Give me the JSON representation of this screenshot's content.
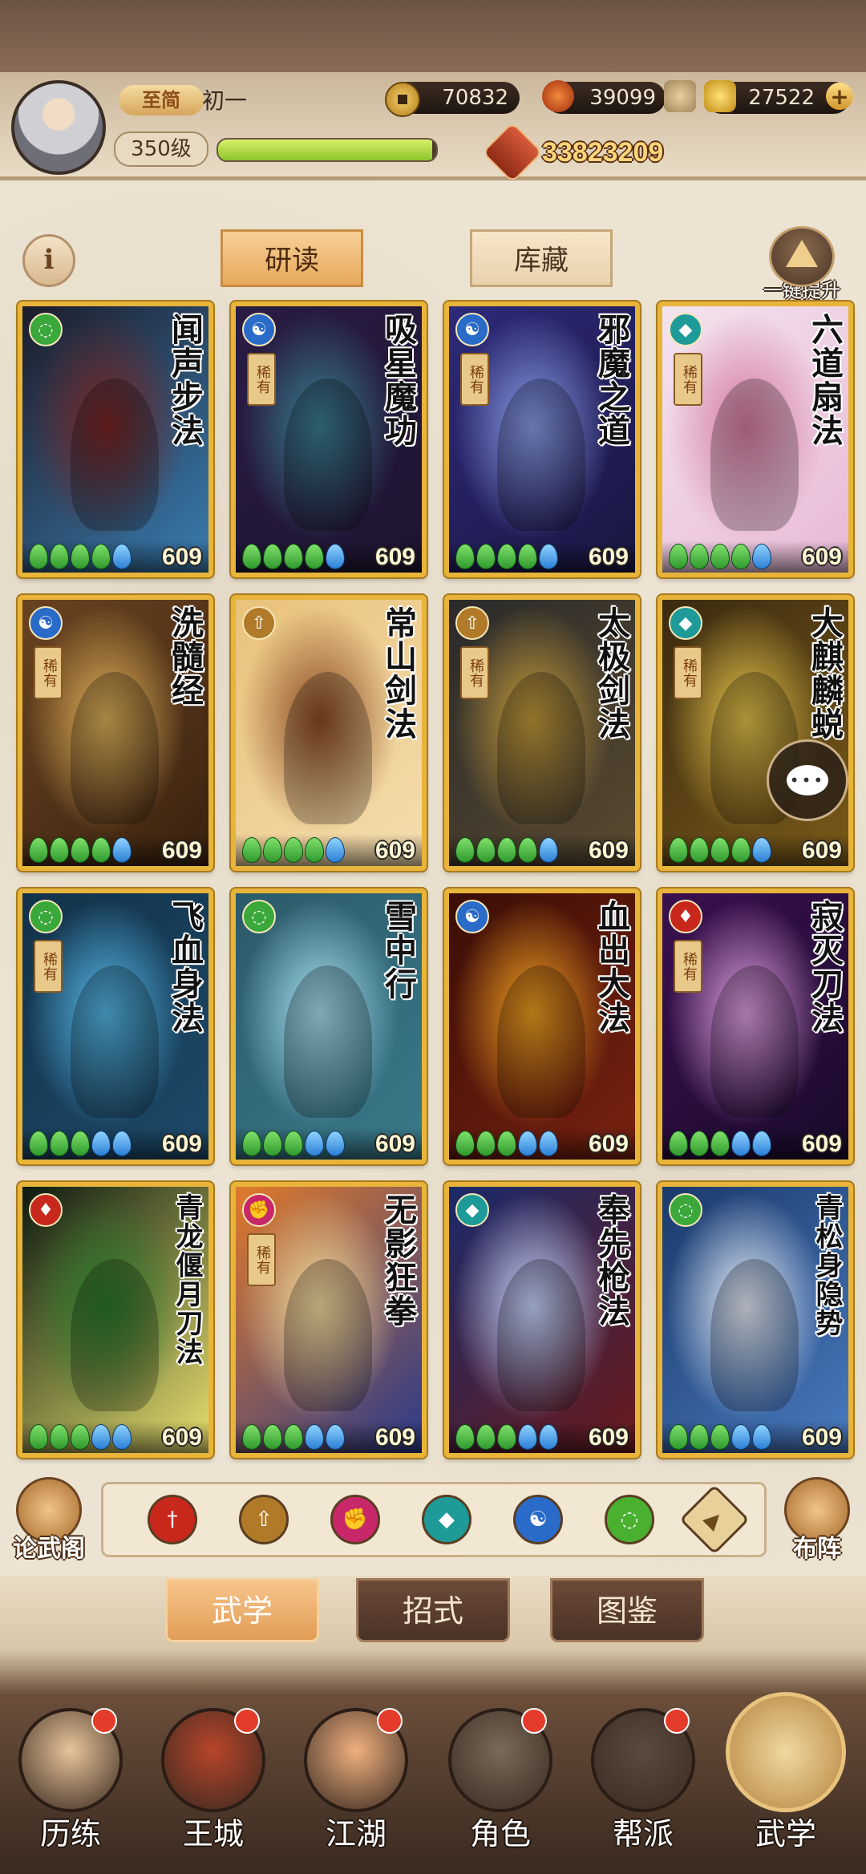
{
  "header": {
    "tier": "至简",
    "player_name": "初一",
    "level": "350级",
    "exp_progress": 0.98,
    "copper": "70832",
    "ingot": "39099",
    "gold": "27522",
    "power": "33823209"
  },
  "tabs": {
    "study": "研读",
    "storage": "库藏"
  },
  "upgrade_all": "一键提升",
  "info": "i",
  "rare_label": "稀有",
  "cards": [
    {
      "title": "闻声步法",
      "school": "green",
      "rare": false,
      "count": "609",
      "stars": [
        "g",
        "g",
        "g",
        "g",
        "b"
      ],
      "palette": [
        "#1c1c2a",
        "#7a2422",
        "#3a7db0"
      ]
    },
    {
      "title": "吸星魔功",
      "school": "blue",
      "rare": true,
      "count": "609",
      "stars": [
        "g",
        "g",
        "g",
        "g",
        "b"
      ],
      "palette": [
        "#2a1c44",
        "#3a8090",
        "#1e1430"
      ]
    },
    {
      "title": "邪魔之道",
      "school": "blue",
      "rare": true,
      "count": "609",
      "stars": [
        "g",
        "g",
        "g",
        "g",
        "b"
      ],
      "palette": [
        "#2d2a7a",
        "#8a9ee8",
        "#1a1640"
      ]
    },
    {
      "title": "六道扇法",
      "school": "teal",
      "rare": true,
      "count": "609",
      "stars": [
        "g",
        "g",
        "g",
        "g",
        "b"
      ],
      "palette": [
        "#f3e4ee",
        "#d47aa0",
        "#e9b8d6"
      ]
    },
    {
      "title": "洗髓经",
      "school": "blue",
      "rare": true,
      "count": "609",
      "stars": [
        "g",
        "g",
        "g",
        "g",
        "b"
      ],
      "palette": [
        "#6a4320",
        "#e0b25a",
        "#3a2210"
      ]
    },
    {
      "title": "常山剑法",
      "school": "gold",
      "rare": false,
      "count": "609",
      "stars": [
        "g",
        "g",
        "g",
        "g",
        "b"
      ],
      "palette": [
        "#e9c27a",
        "#8a4a22",
        "#f4ddb0"
      ]
    },
    {
      "title": "太极剑法",
      "school": "gold",
      "rare": true,
      "count": "609",
      "stars": [
        "g",
        "g",
        "g",
        "g",
        "b"
      ],
      "palette": [
        "#2a2a2a",
        "#c49a3a",
        "#5a4a30"
      ]
    },
    {
      "title": "大麒麟蜕",
      "school": "teal",
      "rare": true,
      "count": "609",
      "stars": [
        "g",
        "g",
        "g",
        "g",
        "b"
      ],
      "palette": [
        "#3a2a10",
        "#e4c24a",
        "#7a5a1a"
      ]
    },
    {
      "title": "飞血身法",
      "school": "green",
      "rare": true,
      "count": "609",
      "stars": [
        "g",
        "g",
        "g",
        "b",
        "b"
      ],
      "palette": [
        "#12324a",
        "#56b8e6",
        "#1e4a6a"
      ]
    },
    {
      "title": "雪中行",
      "school": "green",
      "rare": false,
      "count": "609",
      "stars": [
        "g",
        "g",
        "g",
        "b",
        "b"
      ],
      "palette": [
        "#2c5a6a",
        "#a8e0f0",
        "#3a7a8a"
      ]
    },
    {
      "title": "血出大法",
      "school": "blue",
      "rare": false,
      "count": "609",
      "stars": [
        "g",
        "g",
        "g",
        "b",
        "b"
      ],
      "palette": [
        "#3a0e06",
        "#f0a020",
        "#7a2210"
      ]
    },
    {
      "title": "寂灭刀法",
      "school": "red",
      "rare": true,
      "count": "609",
      "stars": [
        "g",
        "g",
        "g",
        "b",
        "b"
      ],
      "palette": [
        "#3a1050",
        "#e0a0e0",
        "#1a0a2a"
      ]
    },
    {
      "title": "青龙偃月刀法",
      "school": "red",
      "rare": false,
      "count": "609",
      "stars": [
        "g",
        "g",
        "g",
        "b",
        "b"
      ],
      "palette": [
        "#0c1a10",
        "#2a7a2a",
        "#e8e070"
      ]
    },
    {
      "title": "无影狂拳",
      "school": "pink",
      "rare": true,
      "count": "609",
      "stars": [
        "g",
        "g",
        "g",
        "b",
        "b"
      ],
      "palette": [
        "#e07a2a",
        "#f4e0a0",
        "#2a3a8a"
      ]
    },
    {
      "title": "奉先枪法",
      "school": "teal",
      "rare": false,
      "count": "609",
      "stars": [
        "g",
        "g",
        "g",
        "b",
        "b"
      ],
      "palette": [
        "#1a2a6a",
        "#c8d8ff",
        "#6a1a1a"
      ]
    },
    {
      "title": "青松身隐势",
      "school": "green",
      "rare": false,
      "count": "609",
      "stars": [
        "g",
        "g",
        "g",
        "b",
        "b"
      ],
      "palette": [
        "#1a3a6a",
        "#e8eef8",
        "#4a7ac0"
      ]
    }
  ],
  "side_buttons": {
    "left": "论武阁",
    "right": "布阵"
  },
  "filter_icons": [
    {
      "name": "sword-filter-icon",
      "color": "#c8271c"
    },
    {
      "name": "blade-filter-icon",
      "color": "#b07a28"
    },
    {
      "name": "fist-filter-icon",
      "color": "#c8276a"
    },
    {
      "name": "fan-filter-icon",
      "color": "#1e9a98"
    },
    {
      "name": "taiji-filter-icon",
      "color": "#2a6ac8"
    },
    {
      "name": "step-filter-icon",
      "color": "#4ab030"
    },
    {
      "name": "all-filter-icon",
      "color": "#e8d09a"
    }
  ],
  "lower_tabs": [
    "武学",
    "招式",
    "图鉴"
  ],
  "nav": [
    {
      "label": "历练",
      "dot": true
    },
    {
      "label": "王城",
      "dot": true
    },
    {
      "label": "江湖",
      "dot": true
    },
    {
      "label": "角色",
      "dot": true
    },
    {
      "label": "帮派",
      "dot": true
    },
    {
      "label": "武学",
      "dot": false
    }
  ],
  "colors": {
    "card_border": "#e8b43a",
    "green_gem": "#3fae3a",
    "blue_gem": "#2b7fd6",
    "active_tab": "#e7a95c"
  }
}
